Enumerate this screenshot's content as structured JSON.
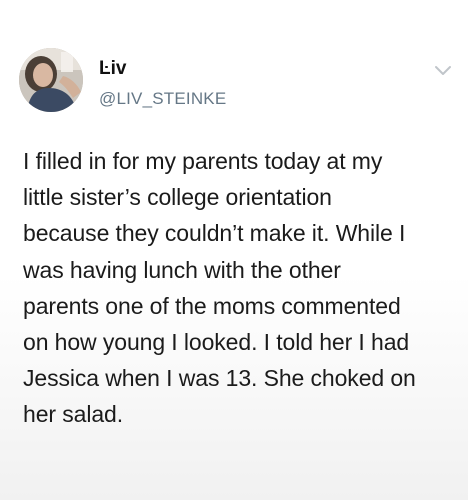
{
  "tweet": {
    "display_name": "Ŀiv",
    "handle": "@LIV_STEINKE",
    "text": "I filled in for my parents today at my\nlittle sister’s college orientation\nbecause they couldn’t make it. While I\nwas having lunch with the other\nparents one of the moms commented\non how young I looked. I told her I had\nJessica when I was 13. She choked on\nher salad.",
    "menu_icon": "chevron-down-icon",
    "avatar_icon": "avatar"
  }
}
